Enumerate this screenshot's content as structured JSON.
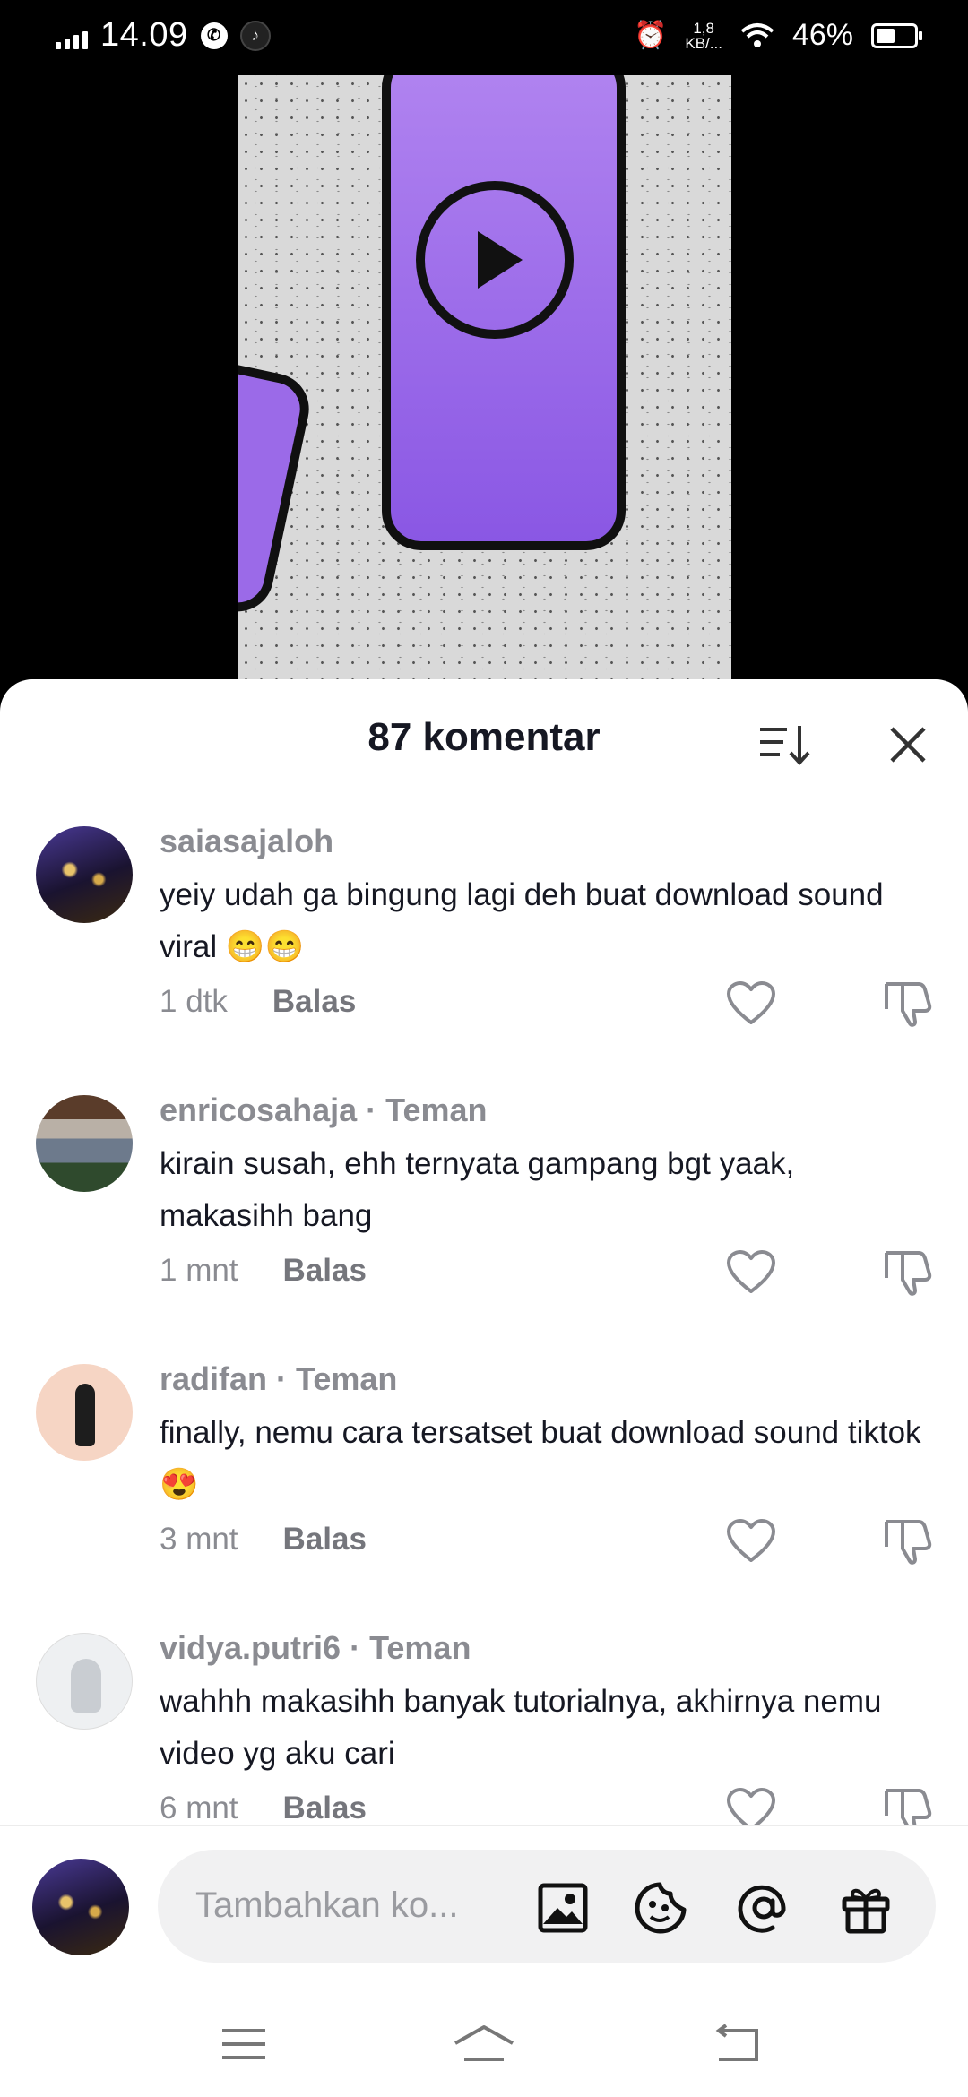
{
  "status_bar": {
    "time": "14.09",
    "speed_value": "1,8",
    "speed_unit": "KB/...",
    "battery": "46%"
  },
  "video": {
    "description": "video preview"
  },
  "comments_sheet": {
    "title": "87 komentar",
    "comments": [
      {
        "username": "saiasajaloh",
        "tag": "",
        "text": "yeiy udah ga bingung lagi deh buat download sound viral 😁😁",
        "time": "1 dtk",
        "reply_label": "Balas"
      },
      {
        "username": "enricosahaja",
        "tag": "· Teman",
        "text": "kirain susah, ehh ternyata gampang bgt yaak, makasihh bang",
        "time": "1 mnt",
        "reply_label": "Balas"
      },
      {
        "username": "radifan",
        "tag": "· Teman",
        "text": "finally, nemu cara tersatset buat download sound tiktok 😍",
        "time": "3 mnt",
        "reply_label": "Balas"
      },
      {
        "username": "vidya.putri6",
        "tag": "· Teman",
        "text": "wahhh makasihh banyak tutorialnya, akhirnya nemu video yg aku cari",
        "time": "6 mnt",
        "reply_label": "Balas"
      }
    ]
  },
  "input_bar": {
    "placeholder": "Tambahkan ko..."
  }
}
